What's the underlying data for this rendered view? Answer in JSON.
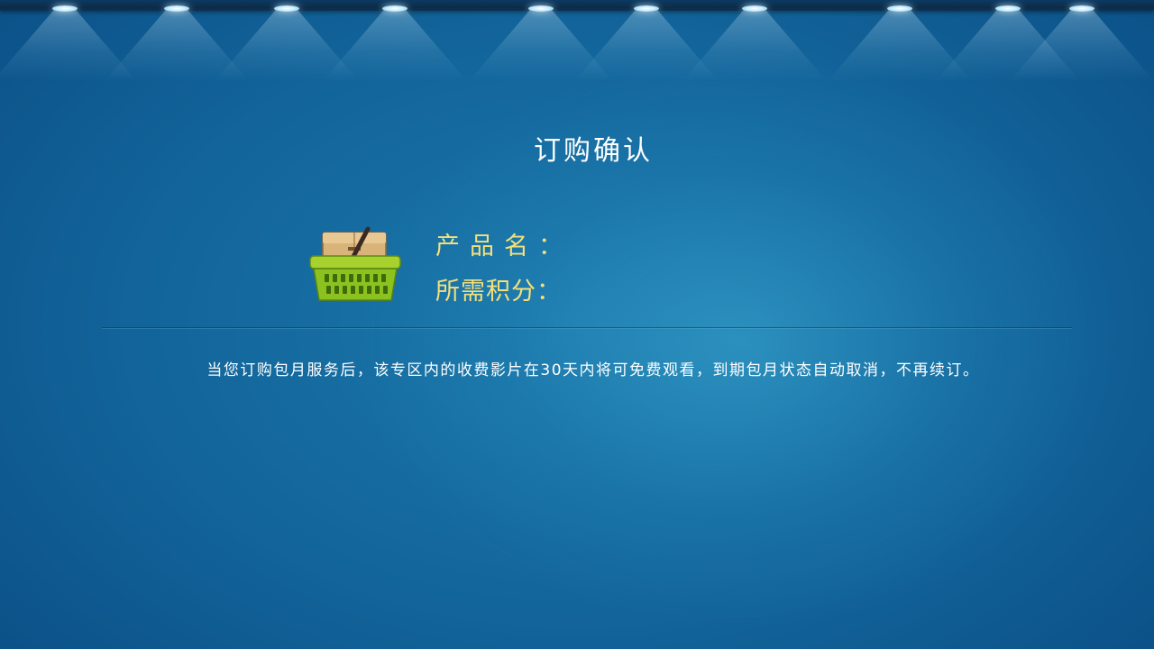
{
  "page": {
    "title": "订购确认"
  },
  "product_info": {
    "icon": "shopping-basket-icon",
    "product_name_label": "产品名：",
    "points_label": "所需积分："
  },
  "notice": {
    "text": "当您订购包月服务后，该专区内的收费影片在30天内将可免费观看，到期包月状态自动取消，不再续订。"
  },
  "colors": {
    "background": "#12649a",
    "title_text": "#ffffff",
    "label_text": "#f4e07a",
    "notice_text": "#ffffff"
  }
}
